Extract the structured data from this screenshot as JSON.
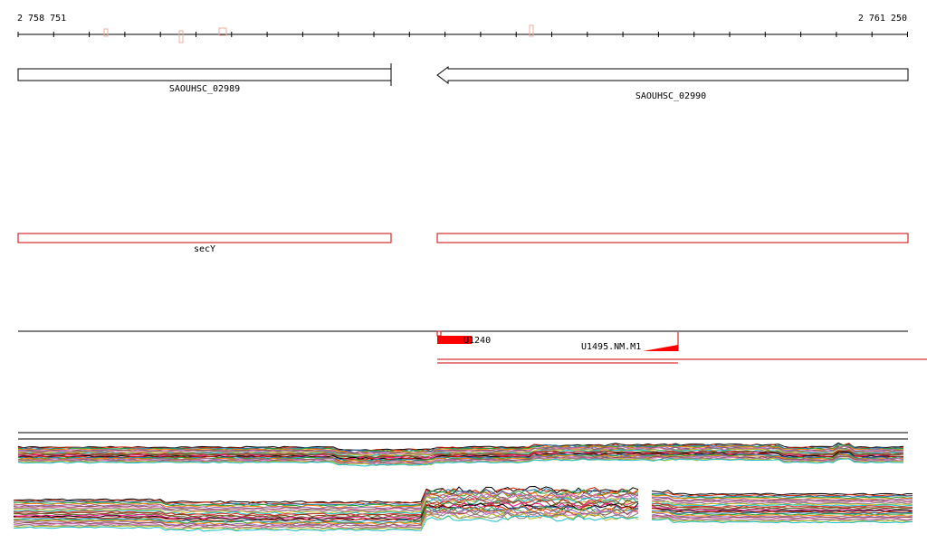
{
  "ruler": {
    "start_label": "2 758 751",
    "end_label": "2 761 250"
  },
  "genes": [
    {
      "name": "SAOUHSC_02989",
      "strand": "+"
    },
    {
      "name": "SAOUHSC_02990",
      "strand": "-"
    }
  ],
  "annotations": [
    {
      "name": "secY"
    }
  ],
  "features": [
    {
      "name": "U1240"
    },
    {
      "name": "U1495.NM.M1"
    }
  ],
  "colors": {
    "gene_outline": "#000000",
    "annotation_outline": "#cc0000",
    "feature_fill": "#ff0000",
    "feature_line": "#cc0000",
    "ruler": "#000000"
  },
  "coverage_tracks": {
    "line_colors": [
      "#000000",
      "#cc2200",
      "#1f77b4",
      "#2ca02c",
      "#ff7f0e",
      "#9467bd",
      "#8c564b",
      "#e377c2",
      "#7f7f7f",
      "#bcbd22",
      "#17becf",
      "#d62728",
      "#8b4513",
      "#556b2f",
      "#ff1493"
    ]
  }
}
